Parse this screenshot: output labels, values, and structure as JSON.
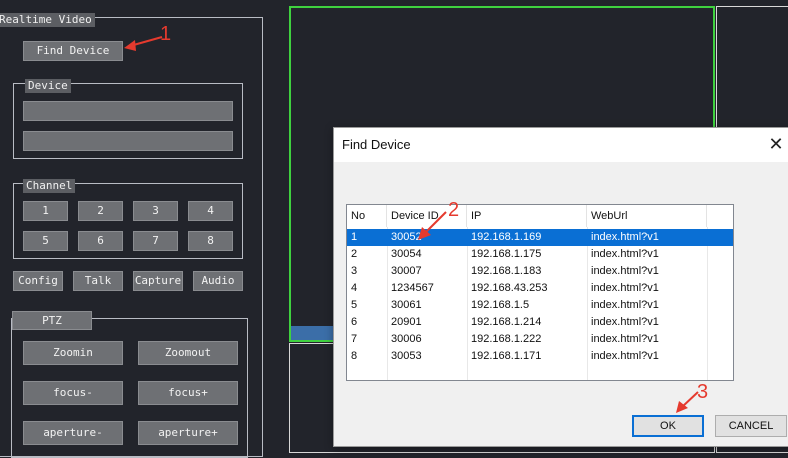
{
  "left_panel": {
    "title": "Realtime Video",
    "find_device_label": "Find Device",
    "device_group_title": "Device",
    "channel_group_title": "Channel",
    "channels": [
      "1",
      "2",
      "3",
      "4",
      "5",
      "6",
      "7",
      "8"
    ],
    "actions": [
      "Config",
      "Talk",
      "Capture",
      "Audio"
    ],
    "ptz_title": "PTZ",
    "ptz_buttons": [
      "Zoomin",
      "Zoomout",
      "focus-",
      "focus+",
      "aperture-",
      "aperture+"
    ]
  },
  "dialog": {
    "title": "Find Device",
    "close_icon": "close-icon",
    "columns": [
      "No",
      "Device ID",
      "IP",
      "WebUrl"
    ],
    "rows": [
      {
        "no": "1",
        "id": "30052",
        "ip": "192.168.1.169",
        "url": "index.html?v1"
      },
      {
        "no": "2",
        "id": "30054",
        "ip": "192.168.1.175",
        "url": "index.html?v1"
      },
      {
        "no": "3",
        "id": "30007",
        "ip": "192.168.1.183",
        "url": "index.html?v1"
      },
      {
        "no": "4",
        "id": "1234567",
        "ip": "192.168.43.253",
        "url": "index.html?v1"
      },
      {
        "no": "5",
        "id": "30061",
        "ip": "192.168.1.5",
        "url": "index.html?v1"
      },
      {
        "no": "6",
        "id": "20901",
        "ip": "192.168.1.214",
        "url": "index.html?v1"
      },
      {
        "no": "7",
        "id": "30006",
        "ip": "192.168.1.222",
        "url": "index.html?v1"
      },
      {
        "no": "8",
        "id": "30053",
        "ip": "192.168.1.171",
        "url": "index.html?v1"
      }
    ],
    "selected_row": "1",
    "ok_label": "OK",
    "cancel_label": "CANCEL"
  },
  "annotations": {
    "step1": "1",
    "step2": "2",
    "step3": "3"
  },
  "colors": {
    "accent": "#0a6fd4",
    "annotation": "#e53a2e",
    "video_active_border": "#3fd13f"
  }
}
